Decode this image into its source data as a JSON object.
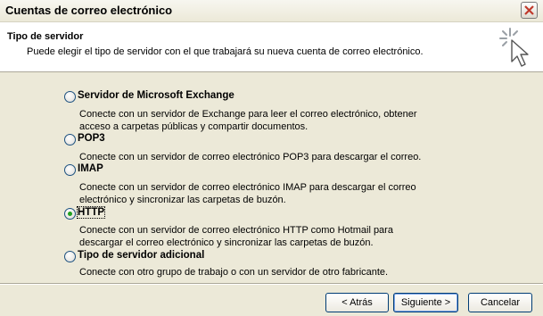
{
  "window": {
    "title": "Cuentas de correo electrónico"
  },
  "header": {
    "title": "Tipo de servidor",
    "description": "Puede elegir el tipo de servidor con el que trabajará su nueva cuenta de correo electrónico."
  },
  "options": [
    {
      "label": "Servidor de Microsoft Exchange",
      "description_lines": [
        "Conecte con un servidor de Exchange para leer el correo electrónico, obtener",
        "acceso a carpetas públicas y compartir documentos."
      ],
      "selected": false
    },
    {
      "label": "POP3",
      "description_lines": [
        "Conecte con un servidor de correo electrónico POP3 para descargar el correo."
      ],
      "selected": false
    },
    {
      "label": "IMAP",
      "description_lines": [
        "Conecte con un servidor de correo electrónico IMAP para descargar el correo",
        "electrónico y sincronizar las carpetas de buzón."
      ],
      "selected": false
    },
    {
      "label": "HTTP",
      "description_lines": [
        "Conecte con un servidor de correo electrónico HTTP como Hotmail para",
        "descargar el correo electrónico y sincronizar las carpetas de buzón."
      ],
      "selected": true
    },
    {
      "label": "Tipo de servidor adicional",
      "description_lines": [
        "Conecte con otro grupo de trabajo o con un servidor de otro fabricante."
      ],
      "selected": false
    }
  ],
  "buttons": {
    "back": "< Atrás",
    "next": "Siguiente >",
    "cancel": "Cancelar"
  },
  "colors": {
    "window_bg": "#ece9d8",
    "radio_selected": "#21a121",
    "close_x": "#c0392b"
  },
  "icons": {
    "close": "close-icon",
    "wizard": "wizard-cursor-icon"
  }
}
